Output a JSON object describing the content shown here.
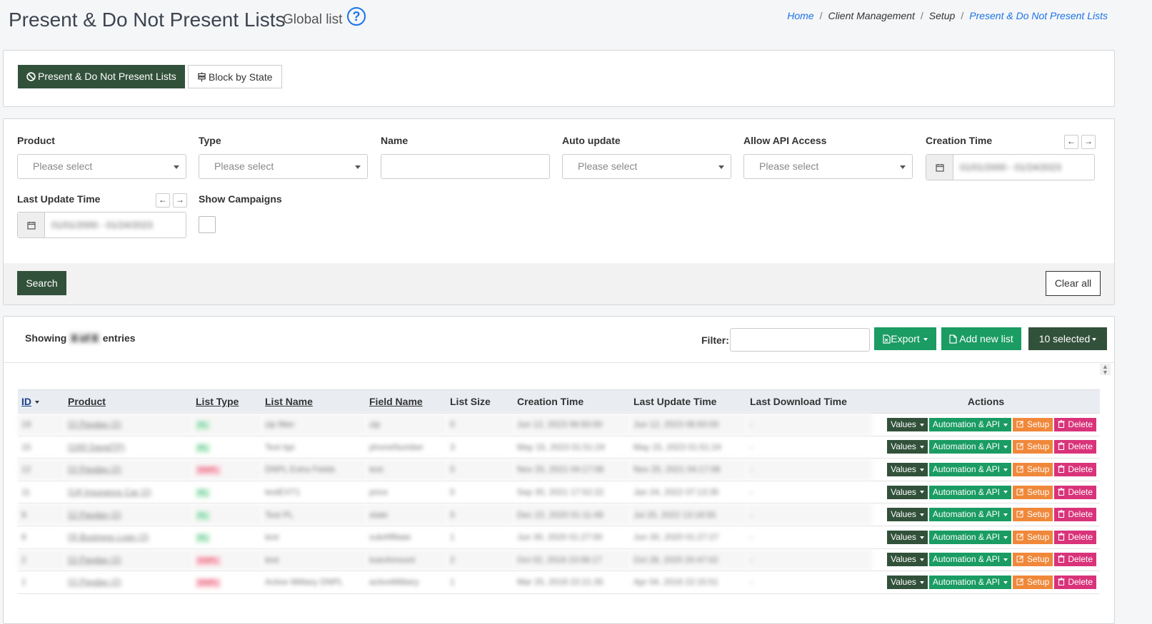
{
  "header": {
    "title": "Present & Do Not Present Lists",
    "subtitle": "Global list",
    "help_glyph": "?",
    "breadcrumb": [
      "Home",
      "Client Management",
      "Setup",
      "Present & Do Not Present Lists"
    ],
    "breadcrumb_sep": "/"
  },
  "tabs": [
    {
      "label": "Present & Do Not Present Lists",
      "icon": "ban-icon",
      "active": true
    },
    {
      "label": "Block by State",
      "icon": "signpost-icon",
      "active": false
    }
  ],
  "filters": {
    "product": {
      "label": "Product",
      "placeholder": "Please select"
    },
    "type": {
      "label": "Type",
      "placeholder": "Please select"
    },
    "name": {
      "label": "Name",
      "value": ""
    },
    "auto_update": {
      "label": "Auto update",
      "placeholder": "Please select"
    },
    "allow_api": {
      "label": "Allow API Access",
      "placeholder": "Please select"
    },
    "creation_time": {
      "label": "Creation Time",
      "value": "01/01/2000 - 01/24/2023"
    },
    "last_update_time": {
      "label": "Last Update Time",
      "value": "01/01/2000 - 01/24/2023"
    },
    "show_campaigns": {
      "label": "Show Campaigns",
      "checked": false
    },
    "search_label": "Search",
    "clear_label": "Clear all",
    "prev_glyph": "←",
    "next_glyph": "→"
  },
  "table_panel": {
    "showing_prefix": "Showing",
    "showing_count": "8 of 8",
    "showing_suffix": "entries",
    "filter_label": "Filter:",
    "filter_value": "",
    "export_label": "Export",
    "add_label": "Add new list",
    "selected_label": "10 selected",
    "columns": [
      "ID",
      "Product",
      "List Type",
      "List Name",
      "Field Name",
      "List Size",
      "Creation Time",
      "Last Update Time",
      "Last Download Time",
      "Actions"
    ],
    "actions": {
      "values": "Values",
      "automation": "Automation & API",
      "setup": "Setup",
      "delete": "Delete"
    },
    "rows": [
      {
        "id": "19",
        "product": "[1] Payday (2)",
        "type": "PL",
        "name": "zip filter",
        "field": "zip",
        "size": "0",
        "created": "Jun 12, 2023 06:50:00",
        "updated": "Jun 12, 2023 06:50:00",
        "downloaded": "-"
      },
      {
        "id": "15",
        "product": "[100] DavidTP)",
        "type": "PL",
        "name": "Test bpi",
        "field": "phoneNumber",
        "size": "3",
        "created": "May 15, 2023 01:51:24",
        "updated": "May 15, 2023 01:51:24",
        "downloaded": "-"
      },
      {
        "id": "12",
        "product": "[1] Payday (2)",
        "type": "DNPL",
        "name": "DNPL Extra Fields",
        "field": "test",
        "size": "0",
        "created": "Nov 25, 2021 04:17:08",
        "updated": "Nov 25, 2021 04:17:08",
        "downloaded": "-"
      },
      {
        "id": "11",
        "product": "[14] Insurance Car (2)",
        "type": "PL",
        "name": "testEXT1",
        "field": "price",
        "size": "0",
        "created": "Sep 30, 2021 17:52:22",
        "updated": "Jan 24, 2022 07:13:35",
        "downloaded": "-"
      },
      {
        "id": "9",
        "product": "[1] Payday (2)",
        "type": "PL",
        "name": "Test PL",
        "field": "state",
        "size": "0",
        "created": "Dec 22, 2020 01:11:49",
        "updated": "Jul 25, 2022 13:18:55",
        "downloaded": "-"
      },
      {
        "id": "6",
        "product": "[3] Business Loan (2)",
        "type": "PL",
        "name": "test",
        "field": "subAffiliate",
        "size": "1",
        "created": "Jun 30, 2020 01:27:00",
        "updated": "Jun 30, 2020 01:27:27",
        "downloaded": "-"
      },
      {
        "id": "2",
        "product": "[1] Payday (2)",
        "type": "DNPL",
        "name": "test",
        "field": "loanAmount",
        "size": "2",
        "created": "Oct 02, 2019 23:56:17",
        "updated": "Oct 28, 2020 20:47:02",
        "downloaded": "-"
      },
      {
        "id": "1",
        "product": "[1] Payday (2)",
        "type": "DNPL",
        "name": "Active Military DNPL",
        "field": "activeMilitary",
        "size": "1",
        "created": "Mar 25, 2019 22:21:35",
        "updated": "Apr 04, 2019 22:15:51",
        "downloaded": "-"
      }
    ]
  },
  "colors": {
    "dark_green": "#32513a",
    "green": "#1a9c63",
    "orange": "#f0883a",
    "pink": "#d9337a",
    "link_blue": "#1a73e8"
  }
}
